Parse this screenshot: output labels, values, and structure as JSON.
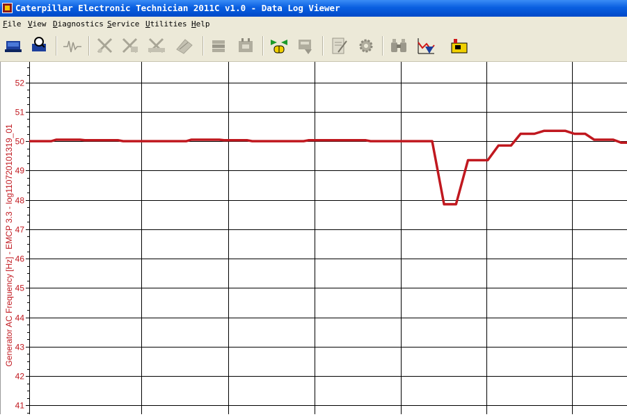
{
  "window": {
    "title": "Caterpillar Electronic Technician 2011C v1.0 - Data Log Viewer"
  },
  "menu": [
    {
      "accel": "F",
      "rest": "ile"
    },
    {
      "accel": "V",
      "rest": "iew"
    },
    {
      "accel": "D",
      "rest": "iagnostics"
    },
    {
      "accel": "S",
      "rest": "ervice"
    },
    {
      "accel": "U",
      "rest": "tilities"
    },
    {
      "accel": "H",
      "rest": "elp"
    }
  ],
  "toolbar": {
    "icons": [
      "connect-icon",
      "search-ecm-icon",
      "status-waveform-icon",
      "diagnostic-tool-1-icon",
      "diagnostic-tool-2-icon",
      "diagnostic-tool-3-icon",
      "diagnostic-tool-4-icon",
      "stack-icon",
      "module-icon",
      "flash-icon",
      "record-icon",
      "edit-document-icon",
      "settings-gear-icon",
      "binoculars-icon",
      "graph-flag-icon",
      "battery-icon"
    ]
  },
  "colors": {
    "series": "#c0181f",
    "axis_text": "#c0181f",
    "grid": "#000000",
    "titlebar": "#0a5fe0"
  },
  "chart_data": {
    "type": "line",
    "ylabel": "Generator AC Frequency [Hz] - EMCP 3.3 - log110720101319_01",
    "ylim": [
      40.7,
      52.7
    ],
    "yticks": [
      41,
      42,
      43,
      44,
      45,
      46,
      47,
      48,
      49,
      50,
      51,
      52
    ],
    "xlim": [
      0,
      1
    ],
    "x_gridlines": [
      0.187,
      0.333,
      0.477,
      0.622,
      0.765,
      0.908
    ],
    "grid": true,
    "series": [
      {
        "values": [
          [
            0.0,
            50.0
          ],
          [
            0.037,
            50.0
          ],
          [
            0.045,
            50.05
          ],
          [
            0.085,
            50.05
          ],
          [
            0.093,
            50.03
          ],
          [
            0.149,
            50.03
          ],
          [
            0.157,
            50.0
          ],
          [
            0.263,
            50.0
          ],
          [
            0.271,
            50.05
          ],
          [
            0.318,
            50.05
          ],
          [
            0.326,
            50.03
          ],
          [
            0.365,
            50.03
          ],
          [
            0.373,
            50.0
          ],
          [
            0.459,
            50.0
          ],
          [
            0.467,
            50.03
          ],
          [
            0.563,
            50.03
          ],
          [
            0.571,
            50.0
          ],
          [
            0.674,
            50.0
          ],
          [
            0.694,
            47.85
          ],
          [
            0.714,
            47.85
          ],
          [
            0.734,
            49.35
          ],
          [
            0.767,
            49.35
          ],
          [
            0.785,
            49.85
          ],
          [
            0.806,
            49.85
          ],
          [
            0.822,
            50.25
          ],
          [
            0.845,
            50.25
          ],
          [
            0.861,
            50.35
          ],
          [
            0.897,
            50.35
          ],
          [
            0.912,
            50.25
          ],
          [
            0.93,
            50.25
          ],
          [
            0.945,
            50.05
          ],
          [
            0.977,
            50.05
          ],
          [
            0.99,
            49.95
          ],
          [
            1.0,
            49.95
          ]
        ]
      }
    ]
  }
}
